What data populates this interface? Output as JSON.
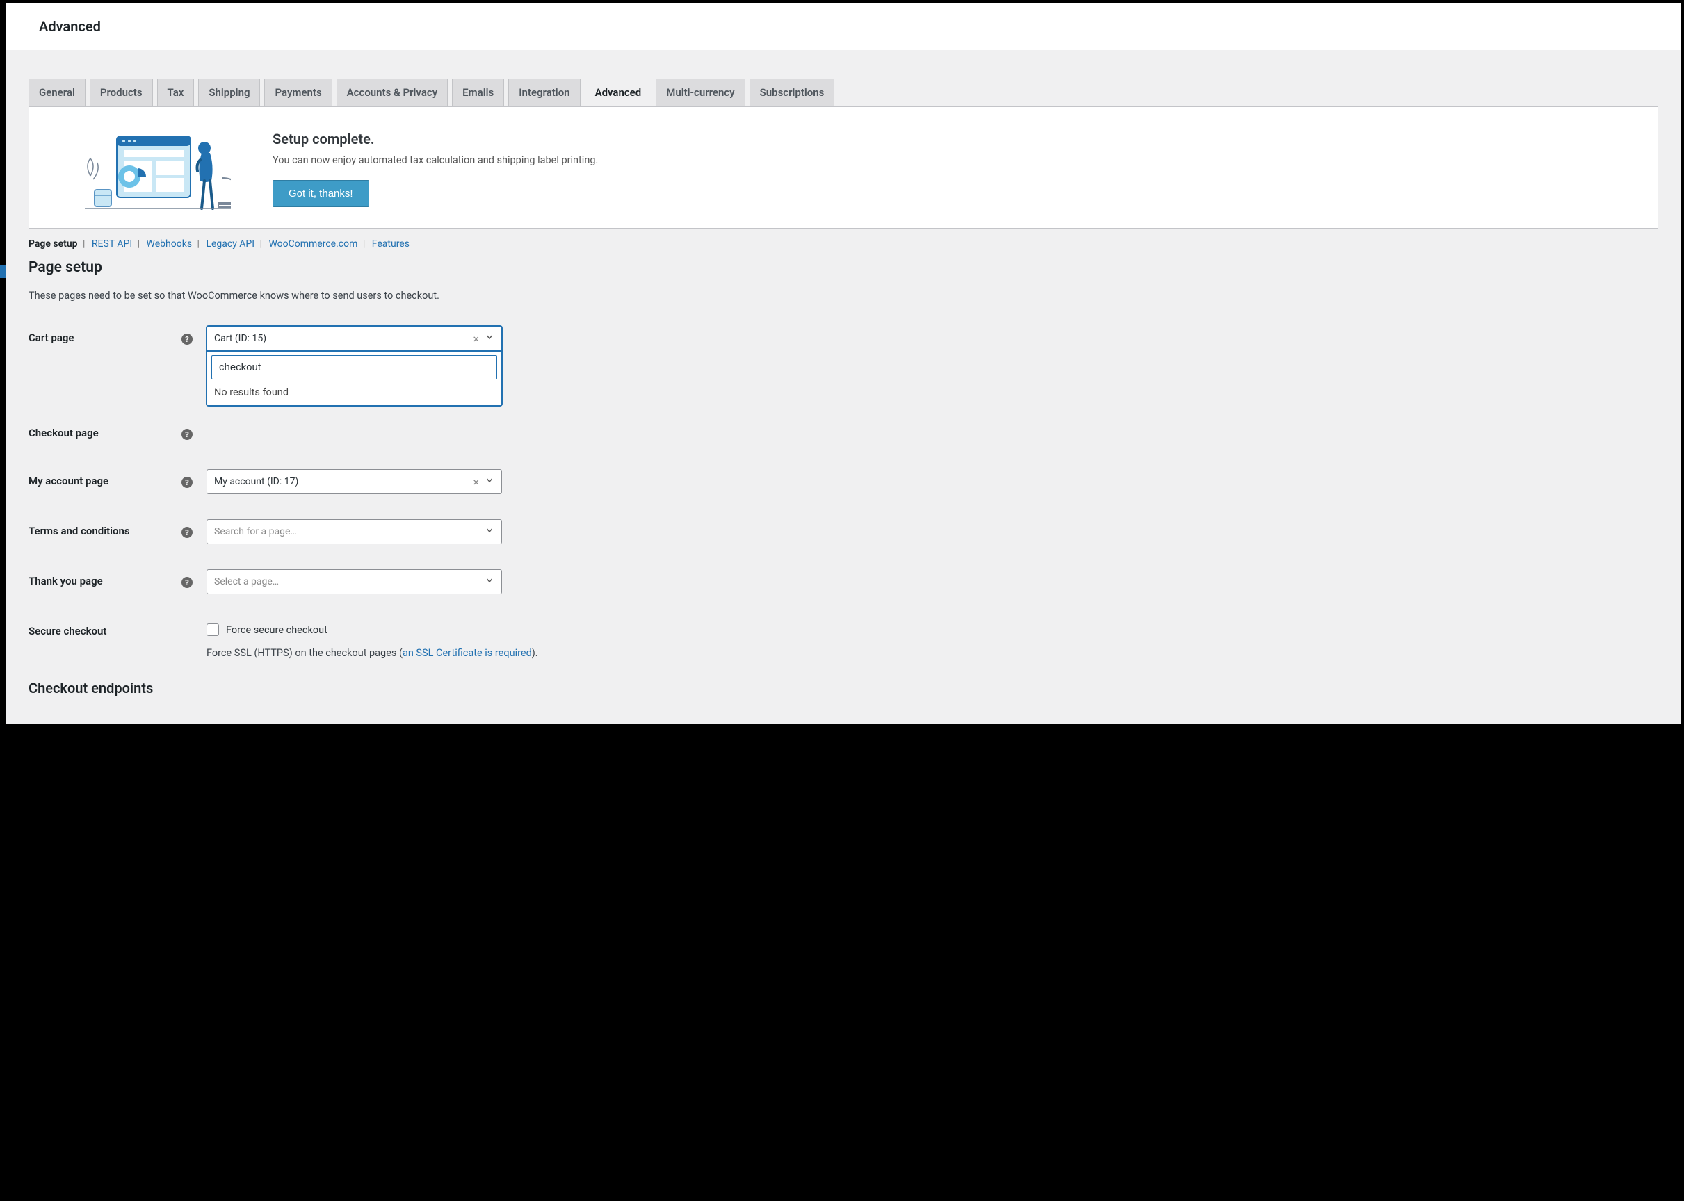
{
  "header": {
    "title": "Advanced"
  },
  "tabs": [
    {
      "label": "General"
    },
    {
      "label": "Products"
    },
    {
      "label": "Tax"
    },
    {
      "label": "Shipping"
    },
    {
      "label": "Payments"
    },
    {
      "label": "Accounts & Privacy"
    },
    {
      "label": "Emails"
    },
    {
      "label": "Integration"
    },
    {
      "label": "Advanced",
      "active": true
    },
    {
      "label": "Multi-currency"
    },
    {
      "label": "Subscriptions"
    }
  ],
  "notice": {
    "title": "Setup complete.",
    "desc": "You can now enjoy automated tax calculation and shipping label printing.",
    "button": "Got it, thanks!"
  },
  "subnav": [
    {
      "label": "Page setup",
      "active": true
    },
    {
      "label": "REST API"
    },
    {
      "label": "Webhooks"
    },
    {
      "label": "Legacy API"
    },
    {
      "label": "WooCommerce.com"
    },
    {
      "label": "Features"
    }
  ],
  "section": {
    "title": "Page setup",
    "desc": "These pages need to be set so that WooCommerce knows where to send users to checkout."
  },
  "fields": {
    "cart": {
      "label": "Cart page",
      "value": "Cart (ID: 15)",
      "search_value": "checkout",
      "no_results": "No results found"
    },
    "checkout": {
      "label": "Checkout page"
    },
    "account": {
      "label": "My account page",
      "value": "My account (ID: 17)"
    },
    "terms": {
      "label": "Terms and conditions",
      "placeholder": "Search for a page…"
    },
    "thankyou": {
      "label": "Thank you page",
      "placeholder": "Select a page…"
    },
    "secure": {
      "label": "Secure checkout",
      "checkbox_label": "Force secure checkout",
      "note_prefix": "Force SSL (HTTPS) on the checkout pages (",
      "note_link": "an SSL Certificate is required",
      "note_suffix": ")."
    }
  },
  "subsection": {
    "title": "Checkout endpoints"
  },
  "icons": {
    "help": "?",
    "clear": "×"
  }
}
